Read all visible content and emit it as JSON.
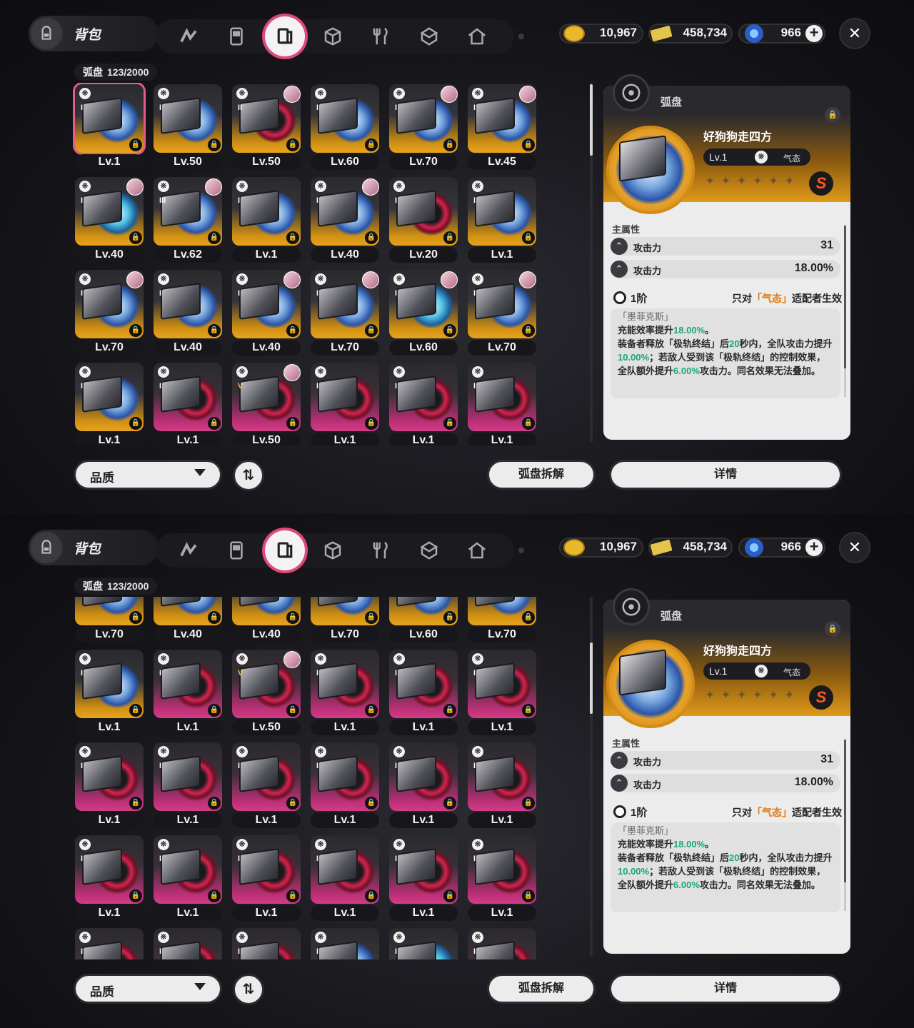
{
  "header": {
    "title": "背包",
    "nav_tabs": [
      "agent-icon",
      "gameboy-icon",
      "disc-case-icon",
      "cube-icon",
      "fork-knife-icon",
      "package-icon",
      "house-icon"
    ],
    "active_tab": "disc-case-icon"
  },
  "currencies": [
    {
      "icon": "gold-coin-icon",
      "value": "10,967"
    },
    {
      "icon": "ticket-icon",
      "value": "458,734"
    },
    {
      "icon": "blue-crystal-icon",
      "value": "966"
    }
  ],
  "inventory": {
    "label": "弧盘",
    "count": "123/2000",
    "screen1_cards": [
      {
        "lv": "Lv.1",
        "rank": "I",
        "rarity": "gold",
        "disc": "b",
        "selected": true,
        "avatar": false
      },
      {
        "lv": "Lv.50",
        "rank": "I",
        "rarity": "gold",
        "disc": "b",
        "avatar": false
      },
      {
        "lv": "Lv.50",
        "rank": "II",
        "rarity": "gold",
        "disc": "r",
        "avatar": true
      },
      {
        "lv": "Lv.60",
        "rank": "I",
        "rarity": "gold",
        "disc": "b",
        "avatar": false
      },
      {
        "lv": "Lv.70",
        "rank": "I",
        "rarity": "gold",
        "disc": "b",
        "avatar": true
      },
      {
        "lv": "Lv.45",
        "rank": "I",
        "rarity": "gold",
        "disc": "b",
        "avatar": true
      },
      {
        "lv": "Lv.40",
        "rank": "I",
        "rarity": "gold",
        "disc": "c",
        "avatar": true
      },
      {
        "lv": "Lv.62",
        "rank": "III",
        "rarity": "gold",
        "disc": "b",
        "avatar": true
      },
      {
        "lv": "Lv.1",
        "rank": "I",
        "rarity": "gold",
        "disc": "b",
        "avatar": false
      },
      {
        "lv": "Lv.40",
        "rank": "I",
        "rarity": "gold",
        "disc": "b",
        "avatar": true
      },
      {
        "lv": "Lv.20",
        "rank": "I",
        "rarity": "gold",
        "disc": "r",
        "avatar": false
      },
      {
        "lv": "Lv.1",
        "rank": "I",
        "rarity": "gold",
        "disc": "b",
        "avatar": false
      },
      {
        "lv": "Lv.70",
        "rank": "I",
        "rarity": "gold",
        "disc": "b",
        "avatar": true
      },
      {
        "lv": "Lv.40",
        "rank": "I",
        "rarity": "gold",
        "disc": "b",
        "avatar": false
      },
      {
        "lv": "Lv.40",
        "rank": "I",
        "rarity": "gold",
        "disc": "b",
        "avatar": true
      },
      {
        "lv": "Lv.70",
        "rank": "I",
        "rarity": "gold",
        "disc": "b",
        "avatar": true
      },
      {
        "lv": "Lv.60",
        "rank": "I",
        "rarity": "gold",
        "disc": "c",
        "avatar": true
      },
      {
        "lv": "Lv.70",
        "rank": "I",
        "rarity": "gold",
        "disc": "b",
        "avatar": true
      },
      {
        "lv": "Lv.1",
        "rank": "I",
        "rarity": "gold",
        "disc": "b",
        "avatar": false
      },
      {
        "lv": "Lv.1",
        "rank": "I",
        "rarity": "pink",
        "disc": "r",
        "avatar": false
      },
      {
        "lv": "Lv.50",
        "rank": "V",
        "rarity": "pink",
        "disc": "r",
        "avatar": true
      },
      {
        "lv": "Lv.1",
        "rank": "I",
        "rarity": "pink",
        "disc": "r",
        "avatar": false
      },
      {
        "lv": "Lv.1",
        "rank": "I",
        "rarity": "pink",
        "disc": "r",
        "avatar": false
      },
      {
        "lv": "Lv.1",
        "rank": "I",
        "rarity": "pink",
        "disc": "r",
        "avatar": false
      }
    ],
    "screen2_partial_row": [
      {
        "lv": "Lv.70"
      },
      {
        "lv": "Lv.40"
      },
      {
        "lv": "Lv.40"
      },
      {
        "lv": "Lv.70"
      },
      {
        "lv": "Lv.60"
      },
      {
        "lv": "Lv.70"
      }
    ],
    "screen2_cards": [
      {
        "lv": "Lv.1",
        "rank": "I",
        "rarity": "gold",
        "disc": "b",
        "avatar": false
      },
      {
        "lv": "Lv.1",
        "rank": "I",
        "rarity": "pink",
        "disc": "r",
        "avatar": false
      },
      {
        "lv": "Lv.50",
        "rank": "V",
        "rarity": "pink",
        "disc": "r",
        "avatar": true
      },
      {
        "lv": "Lv.1",
        "rank": "I",
        "rarity": "pink",
        "disc": "r",
        "avatar": false
      },
      {
        "lv": "Lv.1",
        "rank": "I",
        "rarity": "pink",
        "disc": "r",
        "avatar": false
      },
      {
        "lv": "Lv.1",
        "rank": "I",
        "rarity": "pink",
        "disc": "r",
        "avatar": false
      },
      {
        "lv": "Lv.1",
        "rank": "I",
        "rarity": "pink",
        "disc": "r",
        "avatar": false
      },
      {
        "lv": "Lv.1",
        "rank": "I",
        "rarity": "pink",
        "disc": "r",
        "avatar": false
      },
      {
        "lv": "Lv.1",
        "rank": "I",
        "rarity": "pink",
        "disc": "r",
        "avatar": false
      },
      {
        "lv": "Lv.1",
        "rank": "I",
        "rarity": "pink",
        "disc": "r",
        "avatar": false
      },
      {
        "lv": "Lv.1",
        "rank": "I",
        "rarity": "pink",
        "disc": "r",
        "avatar": false
      },
      {
        "lv": "Lv.1",
        "rank": "I",
        "rarity": "pink",
        "disc": "r",
        "avatar": false
      },
      {
        "lv": "Lv.1",
        "rank": "I",
        "rarity": "pink",
        "disc": "r",
        "avatar": false
      },
      {
        "lv": "Lv.1",
        "rank": "I",
        "rarity": "pink",
        "disc": "r",
        "avatar": false
      },
      {
        "lv": "Lv.1",
        "rank": "I",
        "rarity": "pink",
        "disc": "r",
        "avatar": false
      },
      {
        "lv": "Lv.1",
        "rank": "I",
        "rarity": "pink",
        "disc": "r",
        "avatar": false
      },
      {
        "lv": "Lv.1",
        "rank": "I",
        "rarity": "pink",
        "disc": "r",
        "avatar": false
      },
      {
        "lv": "Lv.1",
        "rank": "I",
        "rarity": "pink",
        "disc": "r",
        "avatar": false
      },
      {
        "lv": "",
        "rank": "I",
        "rarity": "pink",
        "disc": "r",
        "avatar": false
      },
      {
        "lv": "",
        "rank": "I",
        "rarity": "pink",
        "disc": "r",
        "avatar": false
      },
      {
        "lv": "",
        "rank": "I",
        "rarity": "pink",
        "disc": "r",
        "avatar": false
      },
      {
        "lv": "",
        "rank": "I",
        "rarity": "gold",
        "disc": "b",
        "avatar": false
      },
      {
        "lv": "",
        "rank": "I",
        "rarity": "gold",
        "disc": "c",
        "avatar": false
      },
      {
        "lv": "",
        "rank": "I",
        "rarity": "pink",
        "disc": "r",
        "avatar": false
      }
    ]
  },
  "detail": {
    "type_label": "弧盘",
    "name": "好狗狗走四方",
    "level": "Lv.1",
    "attribute": "气态",
    "stars": "✦✦✦✦✦✦",
    "grade": "S",
    "main_label": "主属性",
    "stats": [
      {
        "name": "攻击力",
        "value": "31"
      },
      {
        "name": "攻击力",
        "value": "18.00%"
      }
    ],
    "tier": "1阶",
    "cond_prefix": "只对",
    "cond_attr": "「气态」",
    "cond_suffix": "适配者生效",
    "effect_name": "「墨菲克斯」",
    "effect_l1a": "充能效率提升",
    "effect_l1b": "18.00%",
    "effect_l1c": "。",
    "effect_l2a": "装备者释放「极轨终结」后",
    "effect_l2b": "20",
    "effect_l2c": "秒内，全队攻击力提升",
    "effect_l2d": "10.00%",
    "effect_l2e": "；若敌人受到该「极轨终结」的控制效果，全队额外提升",
    "effect_l2f": "6.00%",
    "effect_l2g": "攻击力。同名效果无法叠加。"
  },
  "buttons": {
    "quality": "品质",
    "sort": "⇅",
    "dismantle": "弧盘拆解",
    "details": "详情"
  },
  "colors": {
    "accent": "#e0477c",
    "gold": "#e6a31d",
    "pink": "#d23c86",
    "highlight_green": "#1ba77a",
    "highlight_orange": "#e07a10"
  }
}
